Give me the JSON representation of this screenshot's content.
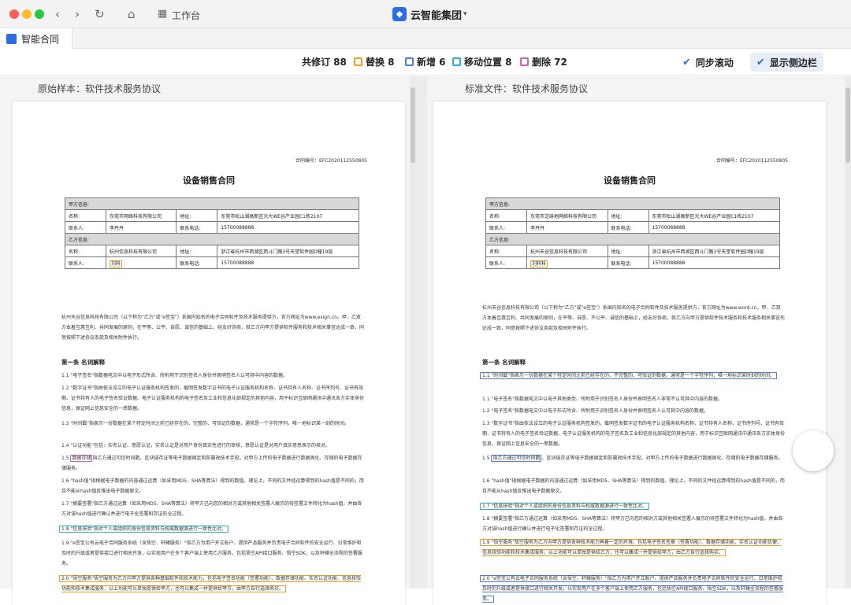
{
  "window": {
    "title_label": "工作台",
    "brand": "云智能集团",
    "tab": "智能合同"
  },
  "toolbar": {
    "total": "共修订 88",
    "replace": "替换 8",
    "add": "新增 6",
    "move": "移动位置 8",
    "delete": "删除 72",
    "sync": "同步滚动",
    "sidebar": "显示侧边栏"
  },
  "colors": {
    "replace": "#f0a020",
    "add": "#4a7be0",
    "move": "#29b3c8",
    "delete": "#cf5fbf",
    "accent": "#2b6de8"
  },
  "left": {
    "header": "原始样本：软件技术服务协议",
    "contract_no": "合同编号：EFC2020112550805",
    "title": "设备销售合同",
    "party_a": {
      "label": "甲方信息:",
      "name_label": "名称:",
      "name": "东莞市网络科技有限公司",
      "addr_label": "地址:",
      "addr": "东莞市松山湖高新区光大WE谷产业园C1栋2107",
      "contact_label": "联系人:",
      "contact": "李丹丹",
      "phone_label": "联系电话:",
      "phone": "15700088888"
    },
    "party_b": {
      "label": "乙方信息:",
      "name_label": "名称:",
      "name": "杭州信息科技有限公司",
      "addr_label": "地址:",
      "addr": "浙江省杭州市西湖区西斗门路3号天堂软件园D幢19层",
      "contact_label": "联系人:",
      "contact": "刘科",
      "phone_label": "联系电话:",
      "phone": "15700088888"
    },
    "intro": "杭州天谷信息科技有限公司（以下称为\"乙方\"或\"e签宝\"）系国内知名的电子合同软件及技术服务提供方，官方网址为www.esign.cn。甲、乙双方本着互惠互利、共同发展的原则，在平等、公平、自愿、诚信的基础上，经友好协商，就乙方向甲方提供软件服务和技术相关事宜达成一致，同意按照下述协议条款及相关附件执行。",
    "section": "第一条  名词解释",
    "p11": "1.1 \"电子签名\"指数据电文中以电子形式所含、所附用于识别签名人身份并表明签名人认可其中内容的数据。",
    "p12": "1.2 \"数字证书\"指由依法设立的电子认证服务机构签发的，载明签发数字证书的电子认证服务机构名称、证书持有人名称、证书序列号、证书有效期、证书持有人的电子签名验证数据、电子认证服务机构的电子签名及工业和信息化部规定的其他内容，用于标识互联网通讯中通讯各方实体身份信息，保证网上信息安全的一串数据。",
    "p13": "1.3 \"时间戳\"指表示一份数据在某个特定时间之前已经存在的、完整的、可验证的数据，通常是一个字符序列，唯一地标识某一刻的时间。",
    "p14": "1.4 \"认证功能\"包括：实名认证、意愿认证，实名认证是对用户身份真实性进行的审核，意愿认证是对用户真实意思表示的核对。",
    "p15a": "1.5 ",
    "p15h": "数据存储",
    "p15b": "指乙方通过可信时间戳、区块链存证等电子数据固定和防篡改技术手段，对甲方上传的电子数据进行数据固化、存储的电子数据存储服务。",
    "p16": "1.6 \"hash值\"指根据电子数据的内容通过运算（如采用MD5、SHA等算法）得到的数值，理论上，不同的文件经运算得到的hash值是不同的，而且不能从hash值反推出电子数据原文。",
    "p17": "1.7 \"摘要签署\"指乙方通过运算（如采用MD5、SHA等算法）将甲方已向您的相对方或其他相关签署人展示的待签署文件转化为hash值，并由各方对该hash值进行确认并进行电子化签署和存证的全过程。",
    "p18": "1.8 \"信息核验\"指对个人或组织的身份信息资料与权威数据源进行一致性比对。",
    "p19": "1.9 \"e签宝公有云电子合同服务系统（含悟空、轩辕服务）\"指乙方为用户开立账户、提供产品服务并负责电子合同软件的安全运行、日常维护和及时的升级或者提供接口进行相关开发，以实现用户在多个客户端上使用乙方服务，包括悟空API接口服务、悟空SDK，以及轩辕全流程的签署服务。",
    "p20": "2.0 \"悟空服务\"悟空服务为乙方向甲方提供各种基础软件和技术能力，包括电子签名功能（签署功能）、数据存储功能、实名认证功能、信息核验功能和技术集成服务，以上功能可以单独提供给甲方，也可以集成一并提供给甲方，由甲方自行选择购买。"
  },
  "right": {
    "header": "标准文件：软件技术服务协议",
    "contract_no": "合同编号：EFC2020112550805",
    "title": "设备销售合同",
    "party_a": {
      "label": "甲方信息:",
      "name_label": "名称:",
      "name": "东莞市芝麻地网络科技有限公司",
      "addr_label": "地址:",
      "addr": "东莞市松山湖高新区光大WE谷产业园C1栋2107",
      "contact_label": "联系人:",
      "contact": "李丹丹",
      "phone_label": "联系电话:",
      "phone": "15700088888"
    },
    "party_b": {
      "label": "乙方信息:",
      "name_label": "名称:",
      "name": "杭州天谷信息科技有限公司",
      "addr_label": "地址:",
      "addr": "浙江省杭州市西湖区西斗门路3号天堂软件园D幢19层",
      "contact_label": "联系人:",
      "contact": "刘科科",
      "phone_label": "联系电话:",
      "phone": "15700088888"
    },
    "intro": "杭州天谷信息科技有限公司（以下称为\"乙方\"或\"e签宝\"）系国内知名的电子合同软件及技术服务提供方，官方网址为www.word.cn。甲、乙双方本着互惠互利、共同发展的原则，在平等、自愿、不公平、诚信的基础上，经友好协商，就乙方向甲方提供软件技术服务和技术服务相关事宜先达成一致，同意按照下述协议条款及相关附件执行。",
    "section": "第一条  名词解释",
    "p11": "1.1 \"时间戳\"指表示一份数据在某个特定时间之前已经存在的、不完整的、可验证的数据，通常是一个字符序列，唯一地标识某时刻的时间。",
    "p12": "1.1 \"电子签名\"指数据电文中以电子其他类型、所附用于识别签名人身份并表明签名人非常不认可其中内容的数据。",
    "p13": "1.2 \"电子签名\"指数据电文中以电子形式所含、所附用于识别签名人身份并表明签名人认可其中内容的数据。",
    "p14": "1.3 \"数字证书\"指由依法设立的电子认证服务机构签发的，载明签发数字证书的电子认证服务机构名称、证书持有人名称、证书序列号、证书有效期、证书持有人的电子签名验证数据、电子认证服务机构的电子签名及工业和信息化部规定的其他内容，用于标识互联网通讯中通讯各方实体身份信息，保证网上信息安全的一串数据。",
    "p15a": "1.5 ",
    "p15h": "指乙方通过可信时间戳",
    "p15b": "、区块链存证等电子数据固定和防篡改技术手段，对甲方上传的电子数据进行数据固化、存储的电子数据存储服务。",
    "p16": "1.6 \"hash值\"指根据电子数据的内容通过运算（如采用MD5、SHA等算法）得到的数值，理论上，不同的文件经运算得到的hash值是不同的，而且不能从hash值反推出电子数据原文。",
    "p17": "1.7 \"信息核验\"指对个人或组织的身份信息资料与权威数据源进行一致性比对。",
    "p18": "1.8 \"摘要签署\"指乙方通过运算（如采用MD5、SHA等算法）将甲方已向您的相对方或其他相关签署人展示的待签署文件转化为hash值，并由各方对该hash值进行确认并进行电子化签署和存证的全过程。",
    "p19": "1.9 \"悟空服务\"悟空服务为乙方向甲方提供各种技术能力再备一定的环境，包括电子签名签章（签署功能）、数据存储功能、实名认证功能优便、信息核验功能和技术集成服务，以上功能可以单独提供给乙方，也可以集成一并提供给甲方，由乙方自行选择购买。",
    "p20": "2.0 \"e签宝公有云电子合同服务系统（含悟空、轩辕服务）\"指乙方为用户开立账户、提供产品服务并负责电子合同软件的安全运行、日常维护和及时的升级或者提供接口进行相关开发，以实现用户在多个客户端上使用乙方服务，包括悟空API接口服务、悟空SDK，以及轩辕全流程的签署服务。"
  }
}
